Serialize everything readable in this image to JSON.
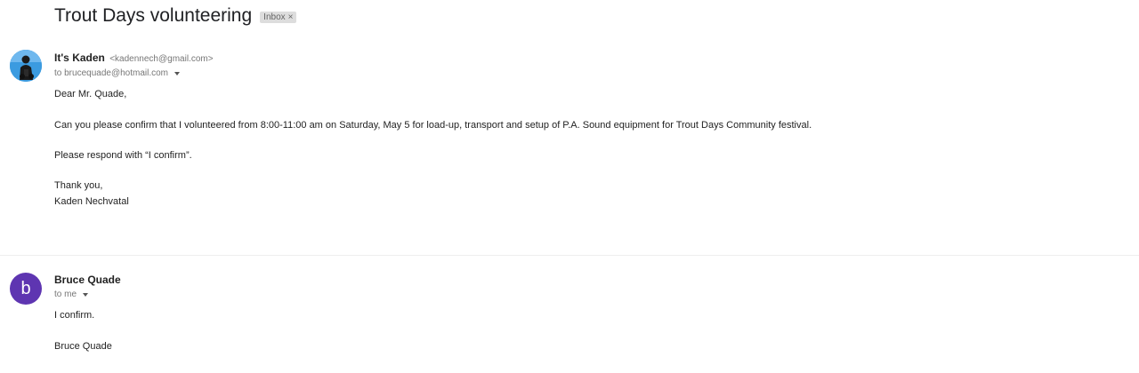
{
  "thread": {
    "subject": "Trout Days volunteering",
    "label": "Inbox",
    "label_remove": "×"
  },
  "messages": [
    {
      "sender_name": "It's Kaden",
      "sender_email": "<kadennech@gmail.com>",
      "recipient": "to brucequade@hotmail.com",
      "body": [
        "Dear  Mr. Quade,",
        "Can you please confirm that I volunteered from 8:00-11:00 am on Saturday, May 5 for load-up, transport and setup of P.A. Sound equipment for Trout Days Community festival.",
        "Please respond with “I confirm”.",
        "Thank you,",
        "Kaden Nechvatal"
      ]
    },
    {
      "sender_name": "Bruce Quade",
      "avatar_letter": "b",
      "recipient": "to me",
      "body": [
        "I confirm.",
        "Bruce Quade"
      ]
    }
  ],
  "colors": {
    "avatar_letter_bg": "#5e35b1",
    "avatar_photo_bg": "#2a8fd6",
    "label_chip_bg": "#dddddd"
  }
}
